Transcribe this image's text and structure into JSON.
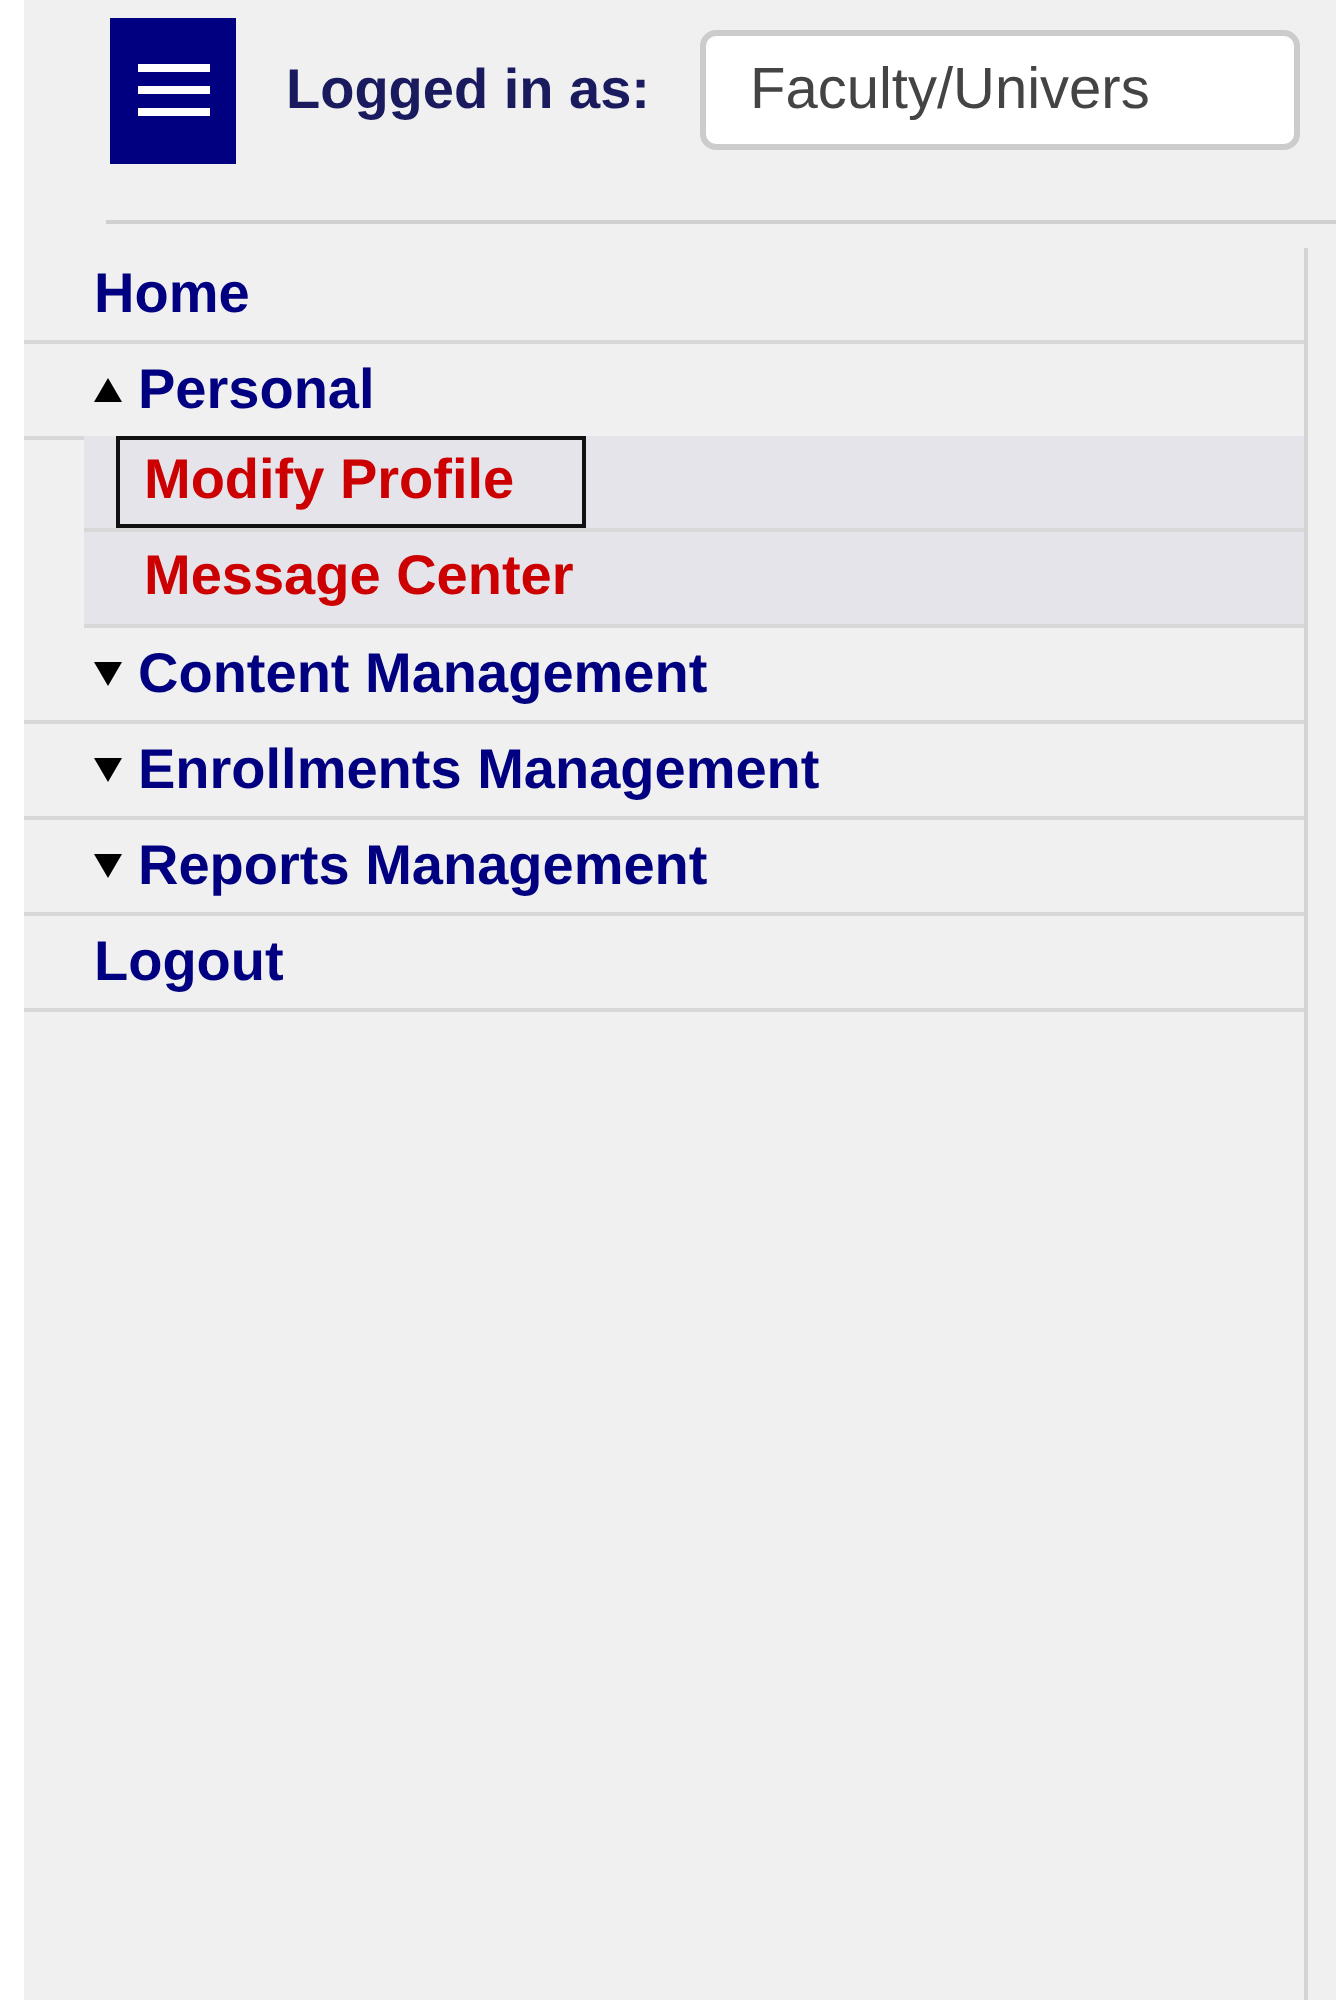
{
  "header": {
    "logged_in_label": "Logged in as:",
    "role_select": {
      "value": "Faculty/Univers"
    }
  },
  "menu": [
    {
      "kind": "link",
      "label": "Home"
    },
    {
      "kind": "group",
      "label": "Personal",
      "expanded": true,
      "children": [
        {
          "label": "Modify Profile",
          "selected": true
        },
        {
          "label": "Message Center",
          "selected": false
        }
      ]
    },
    {
      "kind": "group",
      "label": "Content Management",
      "expanded": false
    },
    {
      "kind": "group",
      "label": "Enrollments Management",
      "expanded": false
    },
    {
      "kind": "group",
      "label": "Reports Management",
      "expanded": false
    },
    {
      "kind": "link",
      "label": "Logout"
    }
  ]
}
